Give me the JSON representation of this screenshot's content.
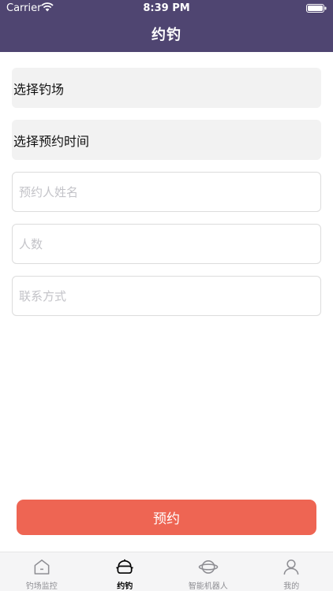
{
  "status_bar": {
    "carrier": "Carrier",
    "time": "8:39 PM"
  },
  "nav": {
    "title": "约钓"
  },
  "form": {
    "select_venue": "选择钓场",
    "select_time": "选择预约时间",
    "name_placeholder": "预约人姓名",
    "count_placeholder": "人数",
    "contact_placeholder": "联系方式"
  },
  "submit_label": "预约",
  "tabs": [
    {
      "label": "钓场监控",
      "icon": "home-icon",
      "active": false
    },
    {
      "label": "约钓",
      "icon": "pot-icon",
      "active": true
    },
    {
      "label": "智能机器人",
      "icon": "planet-icon",
      "active": false
    },
    {
      "label": "我的",
      "icon": "person-icon",
      "active": false
    }
  ],
  "colors": {
    "header": "#4f4571",
    "accent": "#ee6553"
  }
}
